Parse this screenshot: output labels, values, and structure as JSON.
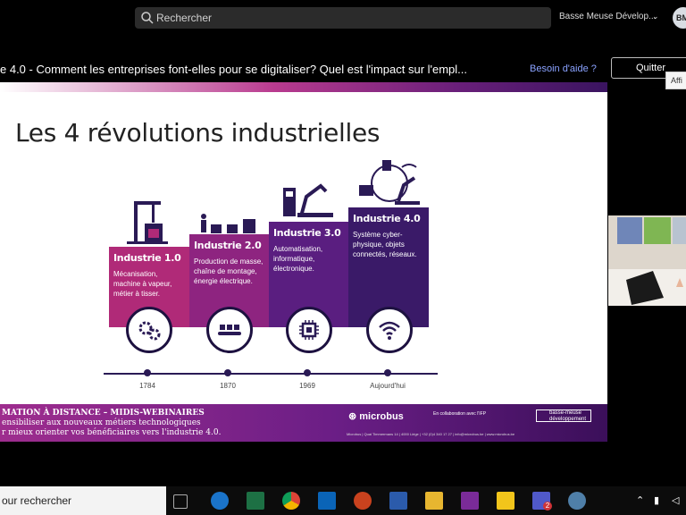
{
  "topbar": {
    "search_placeholder": "Rechercher",
    "org_name": "Basse Meuse Dévelop...",
    "avatar_initials": "BM"
  },
  "meeting": {
    "title": "e 4.0 - Comment les entreprises font-elles pour se digitaliser? Quel est l'impact sur l'empl...",
    "help_link": "Besoin d'aide ?",
    "quit_button": "Quitter",
    "tooltip": "Affi"
  },
  "slide": {
    "title": "Les 4 révolutions industrielles",
    "stages": [
      {
        "name": "Industrie 1.0",
        "desc": "Mécanisation, machine à vapeur, métier à tisser.",
        "year": "1784",
        "color": "#b02a78"
      },
      {
        "name": "Industrie 2.0",
        "desc": "Production de masse, chaîne de montage, énergie électrique.",
        "year": "1870",
        "color": "#8e2480"
      },
      {
        "name": "Industrie 3.0",
        "desc": "Automatisation, informatique, électronique.",
        "year": "1969",
        "color": "#5a1e80"
      },
      {
        "name": "Industrie 4.0",
        "desc": "Système cyber-physique, objets connectés, réseaux.",
        "year": "Aujourd'hui",
        "color": "#3a1a68"
      }
    ],
    "banner": {
      "line1": "MATION À DISTANCE  –  MIDIS-WEBINAIRES",
      "line2": "ensibiliser aux nouveaux métiers technologiques",
      "line3": "r mieux orienter vos bénéficiaires vers l'industrie 4.0.",
      "logo_microbus": "microbus",
      "collab_text": "En collaboration avec l'IFP",
      "logo_bm": "basse-meuse développement",
      "address": "Microbus | Quai Timmermans 14 | 4000 Liège | +32 (0)4 340 17 27 | info@microbus.be | www.microbus.be"
    }
  },
  "taskbar": {
    "search_text": "our rechercher",
    "apps": [
      {
        "name": "task-view",
        "color": "#2b2b2b"
      },
      {
        "name": "edge",
        "color": "#1a73c9"
      },
      {
        "name": "excel",
        "color": "#1d7044"
      },
      {
        "name": "chrome",
        "color": "#e2b21b"
      },
      {
        "name": "outlook",
        "color": "#0a64b7"
      },
      {
        "name": "powerpoint",
        "color": "#c9421e"
      },
      {
        "name": "word",
        "color": "#2b5bab"
      },
      {
        "name": "explorer",
        "color": "#e7b630"
      },
      {
        "name": "onenote",
        "color": "#7a2b98"
      },
      {
        "name": "sticky-notes",
        "color": "#f2c51b"
      },
      {
        "name": "teams",
        "color": "#5059c9"
      },
      {
        "name": "other",
        "color": "#4f7fa8"
      }
    ],
    "teams_badge": "2"
  }
}
